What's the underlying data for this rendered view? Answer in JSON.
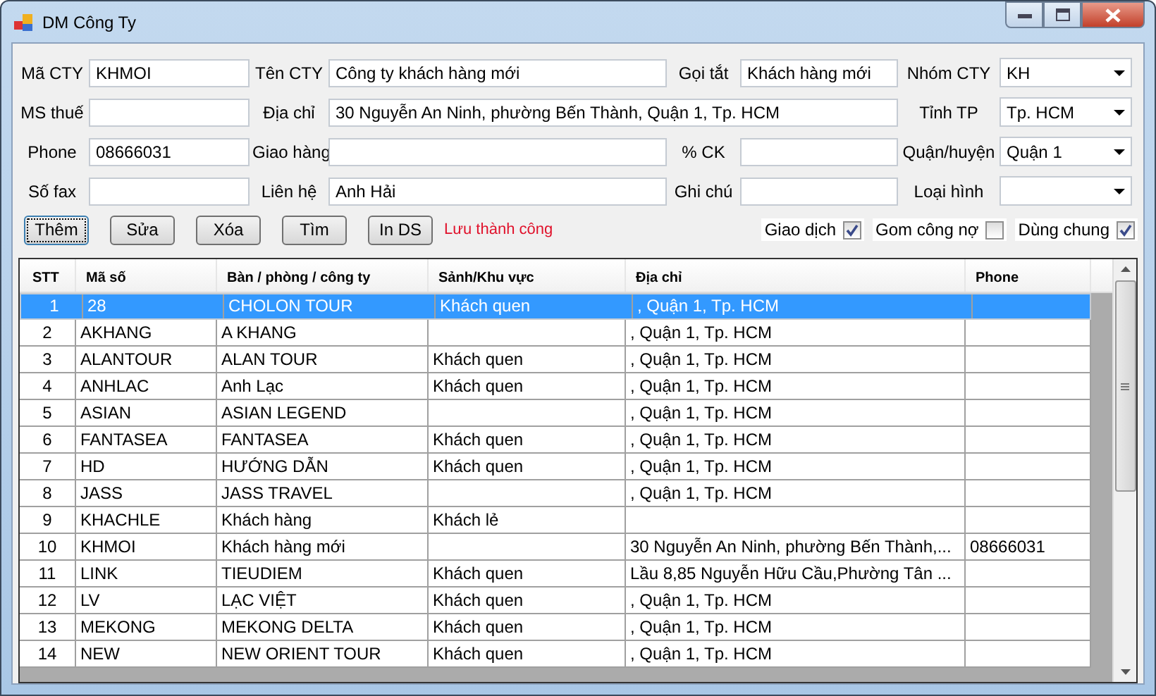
{
  "window": {
    "title": "DM Công Ty"
  },
  "fields": [
    {
      "kind": "text",
      "label": "Mã CTY",
      "value": "KHMOI"
    },
    {
      "kind": "text",
      "label": "Tên CTY",
      "value": "Công ty khách hàng mới"
    },
    {
      "kind": "text",
      "label": "Gọi tắt",
      "value": "Khách hàng mới"
    },
    {
      "kind": "select",
      "label": "Nhóm CTY",
      "value": "KH"
    },
    {
      "kind": "text",
      "label": "MS thuế"
    },
    {
      "kind": "wide",
      "label": "Địa chỉ",
      "value": "30 Nguyễn An Ninh, phường Bến Thành, Quận 1, Tp. HCM"
    },
    {
      "kind": "select",
      "label": "Tỉnh TP",
      "value": "Tp. HCM"
    },
    {
      "kind": "text",
      "label": "Phone",
      "value": "08666031"
    },
    {
      "kind": "text",
      "label": "Giao hàng"
    },
    {
      "kind": "text",
      "label": "% CK"
    },
    {
      "kind": "select",
      "label": "Quận/huyện",
      "value": "Quận 1"
    },
    {
      "kind": "text",
      "label": "Số fax"
    },
    {
      "kind": "text",
      "label": "Liên hệ",
      "value": "Anh Hải"
    },
    {
      "kind": "text",
      "label": "Ghi chú"
    },
    {
      "kind": "select",
      "label": "Loại hình"
    }
  ],
  "buttons": [
    {
      "label": "Thêm",
      "focused": true
    },
    {
      "label": "Sửa",
      "focused": false
    },
    {
      "label": "Xóa",
      "focused": false
    },
    {
      "label": "Tìm",
      "focused": false
    },
    {
      "label": "In DS",
      "focused": false
    }
  ],
  "status_message": "Lưu thành công",
  "checkboxes": [
    {
      "label": "Giao dịch",
      "checked": true
    },
    {
      "label": "Gom công nợ",
      "checked": false
    },
    {
      "label": "Dùng chung",
      "checked": true
    }
  ],
  "table": {
    "columns": [
      "STT",
      "Mã số",
      "Bàn / phòng / công ty",
      "Sảnh/Khu vực",
      "Địa chỉ",
      "Phone"
    ],
    "rows": [
      {
        "selected": true,
        "cells": [
          "1",
          "28",
          "CHOLON TOUR",
          "Khách quen",
          ", Quận 1, Tp. HCM",
          ""
        ]
      },
      {
        "selected": false,
        "cells": [
          "2",
          "AKHANG",
          "A KHANG",
          "",
          ", Quận 1, Tp. HCM",
          ""
        ]
      },
      {
        "selected": false,
        "cells": [
          "3",
          "ALANTOUR",
          "ALAN TOUR",
          "Khách quen",
          ", Quận 1, Tp. HCM",
          ""
        ]
      },
      {
        "selected": false,
        "cells": [
          "4",
          "ANHLAC",
          "Anh Lạc",
          "Khách quen",
          ", Quận 1, Tp. HCM",
          ""
        ]
      },
      {
        "selected": false,
        "cells": [
          "5",
          "ASIAN",
          "ASIAN LEGEND",
          "",
          ", Quận 1, Tp. HCM",
          ""
        ]
      },
      {
        "selected": false,
        "cells": [
          "6",
          "FANTASEA",
          "FANTASEA",
          "Khách quen",
          ", Quận 1, Tp. HCM",
          ""
        ]
      },
      {
        "selected": false,
        "cells": [
          "7",
          "HD",
          "HƯỚNG DẪN",
          "Khách quen",
          ", Quận 1, Tp. HCM",
          ""
        ]
      },
      {
        "selected": false,
        "cells": [
          "8",
          "JASS",
          "JASS TRAVEL",
          "",
          ", Quận 1, Tp. HCM",
          ""
        ]
      },
      {
        "selected": false,
        "cells": [
          "9",
          "KHACHLE",
          "Khách hàng",
          "Khách lẻ",
          "",
          ""
        ]
      },
      {
        "selected": false,
        "cells": [
          "10",
          "KHMOI",
          "Khách hàng mới",
          "",
          "30 Nguyễn An Ninh, phường Bến Thành,...",
          "08666031"
        ]
      },
      {
        "selected": false,
        "cells": [
          "11",
          "LINK",
          "TIEUDIEM",
          "Khách quen",
          "Lầu 8,85 Nguyễn Hữu Cầu,Phường Tân ...",
          ""
        ]
      },
      {
        "selected": false,
        "cells": [
          "12",
          "LV",
          "LẠC VIỆT",
          "Khách quen",
          ", Quận 1, Tp. HCM",
          ""
        ]
      },
      {
        "selected": false,
        "cells": [
          "13",
          "MEKONG",
          "MEKONG DELTA",
          "Khách quen",
          ", Quận 1, Tp. HCM",
          ""
        ]
      },
      {
        "selected": false,
        "cells": [
          "14",
          "NEW",
          "NEW ORIENT TOUR",
          "Khách quen",
          ", Quận 1, Tp. HCM",
          ""
        ]
      }
    ]
  }
}
